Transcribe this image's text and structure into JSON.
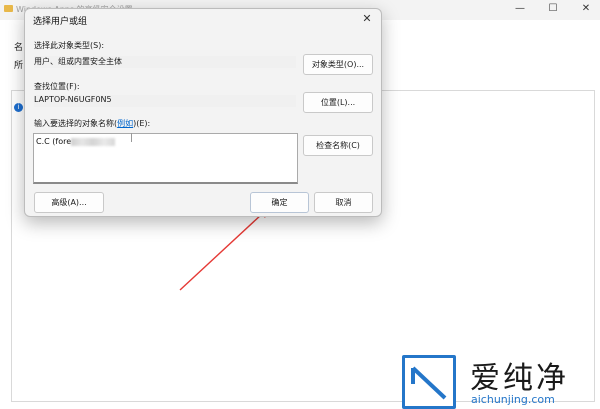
{
  "background_window": {
    "title": "Windows Apps 的高级安全设置",
    "label_1": "名",
    "label_2": "所",
    "info_icon": "info-icon"
  },
  "dialog": {
    "title": "选择用户或组",
    "close_icon": "close-icon",
    "object_type_label": "选择此对象类型(S):",
    "object_type_value": "用户、组或内置安全主体",
    "object_type_button": "对象类型(O)...",
    "location_label": "查找位置(F):",
    "location_value": "LAPTOP-N6UGF0N5",
    "location_button": "位置(L)...",
    "names_label_prefix": "输入要选择的对象名称(",
    "names_label_link": "例如",
    "names_label_suffix": ")(E):",
    "names_value": "C.C (fore",
    "check_names_button": "检查名称(C)",
    "advanced_button": "高级(A)...",
    "ok_button": "确定",
    "cancel_button": "取消"
  },
  "annotation": {
    "arrow_color": "#e53935"
  },
  "watermark": {
    "brand": "爱纯净",
    "url": "aichunjing.com",
    "accent_color": "#2476c9"
  }
}
